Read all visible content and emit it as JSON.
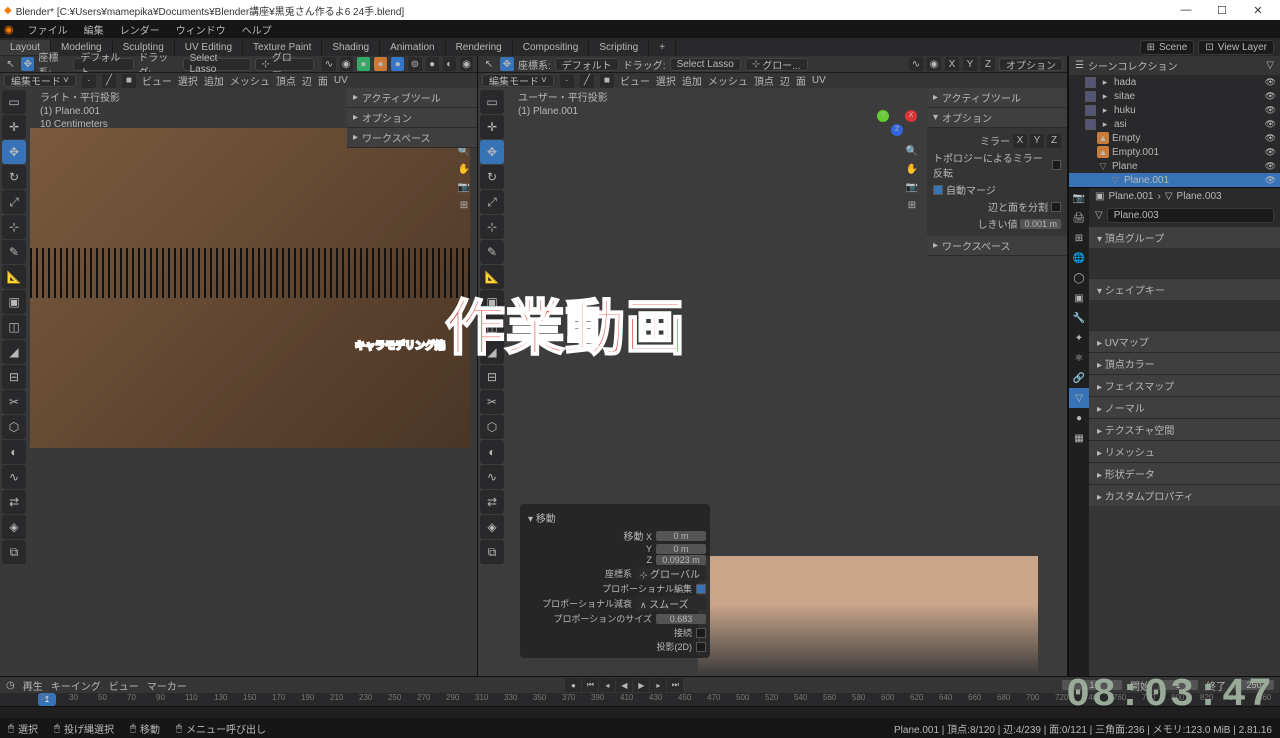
{
  "titlebar": {
    "title": "Blender* [C:¥Users¥mamepika¥Documents¥Blender講座¥黒兎さん作るよ6  24手.blend]"
  },
  "menubar": {
    "items": [
      "ファイル",
      "編集",
      "レンダー",
      "ウィンドウ",
      "ヘルプ"
    ]
  },
  "tabs": [
    "Layout",
    "Modeling",
    "Sculpting",
    "UV Editing",
    "Texture Paint",
    "Shading",
    "Animation",
    "Rendering",
    "Compositing",
    "Scripting"
  ],
  "active_tab": "Layout",
  "scene_field": "Scene",
  "viewlayer_field": "View Layer",
  "vp_header": {
    "mode": "編集モード",
    "coord": "座標系:",
    "pivot": "デフォルト",
    "drag": "ドラッグ:",
    "select": "Select Lasso",
    "transform": "グロー..."
  },
  "vp_menu": [
    "ビュー",
    "選択",
    "追加",
    "メッシュ",
    "頂点",
    "辺",
    "面",
    "UV"
  ],
  "vp1": {
    "info1": "ライト・平行投影",
    "info2": "(1) Plane.001",
    "info3": "10 Centimeters"
  },
  "vp2": {
    "info1": "ユーザー・平行投影",
    "info2": "(1) Plane.001"
  },
  "n_panel": {
    "active_tool": "アクティブツール",
    "options": "オプション",
    "workspace": "ワークスペース",
    "mirror": "ミラー",
    "topo_mirror": "トポロジーによるミラー反転",
    "auto_merge": "自動マージ",
    "split_edge": "辺と面を分割",
    "threshold": "しきい値",
    "threshold_val": "0.001 m"
  },
  "outliner": {
    "title": "シーンコレクション",
    "items": [
      {
        "label": "hada",
        "indent": 1,
        "check": true
      },
      {
        "label": "sitae",
        "indent": 1,
        "check": true
      },
      {
        "label": "huku",
        "indent": 1,
        "check": true
      },
      {
        "label": "asi",
        "indent": 1,
        "check": true
      },
      {
        "label": "Empty",
        "indent": 2,
        "orange": true
      },
      {
        "label": "Empty.001",
        "indent": 2,
        "orange": true
      },
      {
        "label": "Plane",
        "indent": 2,
        "mesh": true
      },
      {
        "label": "Plane.001",
        "indent": 3,
        "mesh": true,
        "sel": true
      }
    ]
  },
  "props": {
    "breadcrumb1": "Plane.001",
    "breadcrumb2": "Plane.003",
    "data_name": "Plane.003",
    "sections": [
      "頂点グループ",
      "シェイプキー",
      "UVマップ",
      "頂点カラー",
      "フェイスマップ",
      "ノーマル",
      "テクスチャ空間",
      "リメッシュ",
      "形状データ",
      "カスタムプロパティ"
    ]
  },
  "move_panel": {
    "title": "移動",
    "move": "移動",
    "x": "0 m",
    "y": "0 m",
    "z": "0.0923 m",
    "orient": "座標系",
    "orient_val": "グローバル",
    "prop_edit": "プロポーショナル編集",
    "falloff": "プロポーショナル減衰",
    "falloff_val": "スムーズ",
    "size": "プロポーションのサイズ",
    "size_val": "0.683",
    "connected": "接続",
    "proj2d": "投影(2D)"
  },
  "timeline": {
    "menu": [
      "再生",
      "キーイング",
      "ビュー",
      "マーカー"
    ],
    "ticks": [
      10,
      30,
      50,
      70,
      90,
      110,
      130,
      150,
      170,
      190,
      210,
      230,
      250,
      270,
      290,
      310,
      330,
      350,
      370,
      390,
      410,
      430,
      450,
      470,
      500,
      520,
      540,
      560,
      580,
      600,
      620,
      640,
      660,
      680,
      700,
      720,
      740,
      760,
      780,
      800,
      820,
      840,
      860
    ],
    "current": "1",
    "start_lbl": "開始",
    "start": "1",
    "end_lbl": "終了",
    "end": "250",
    "frame": "1"
  },
  "statusbar": {
    "select": "選択",
    "box": "投げ縄選択",
    "move": "移動",
    "menu": "メニュー呼び出し",
    "info": "Plane.001 | 頂点:8/120 | 辺:4/239 | 面:0/121 | 三角面:236 | メモリ:123.0 MiB | 2.81.16"
  },
  "overlay": {
    "t1": "キャラモデリング編",
    "t2": "作業動画",
    "time": "08:03:47"
  },
  "axes": {
    "x": "X",
    "y": "Y",
    "z": "Z"
  }
}
